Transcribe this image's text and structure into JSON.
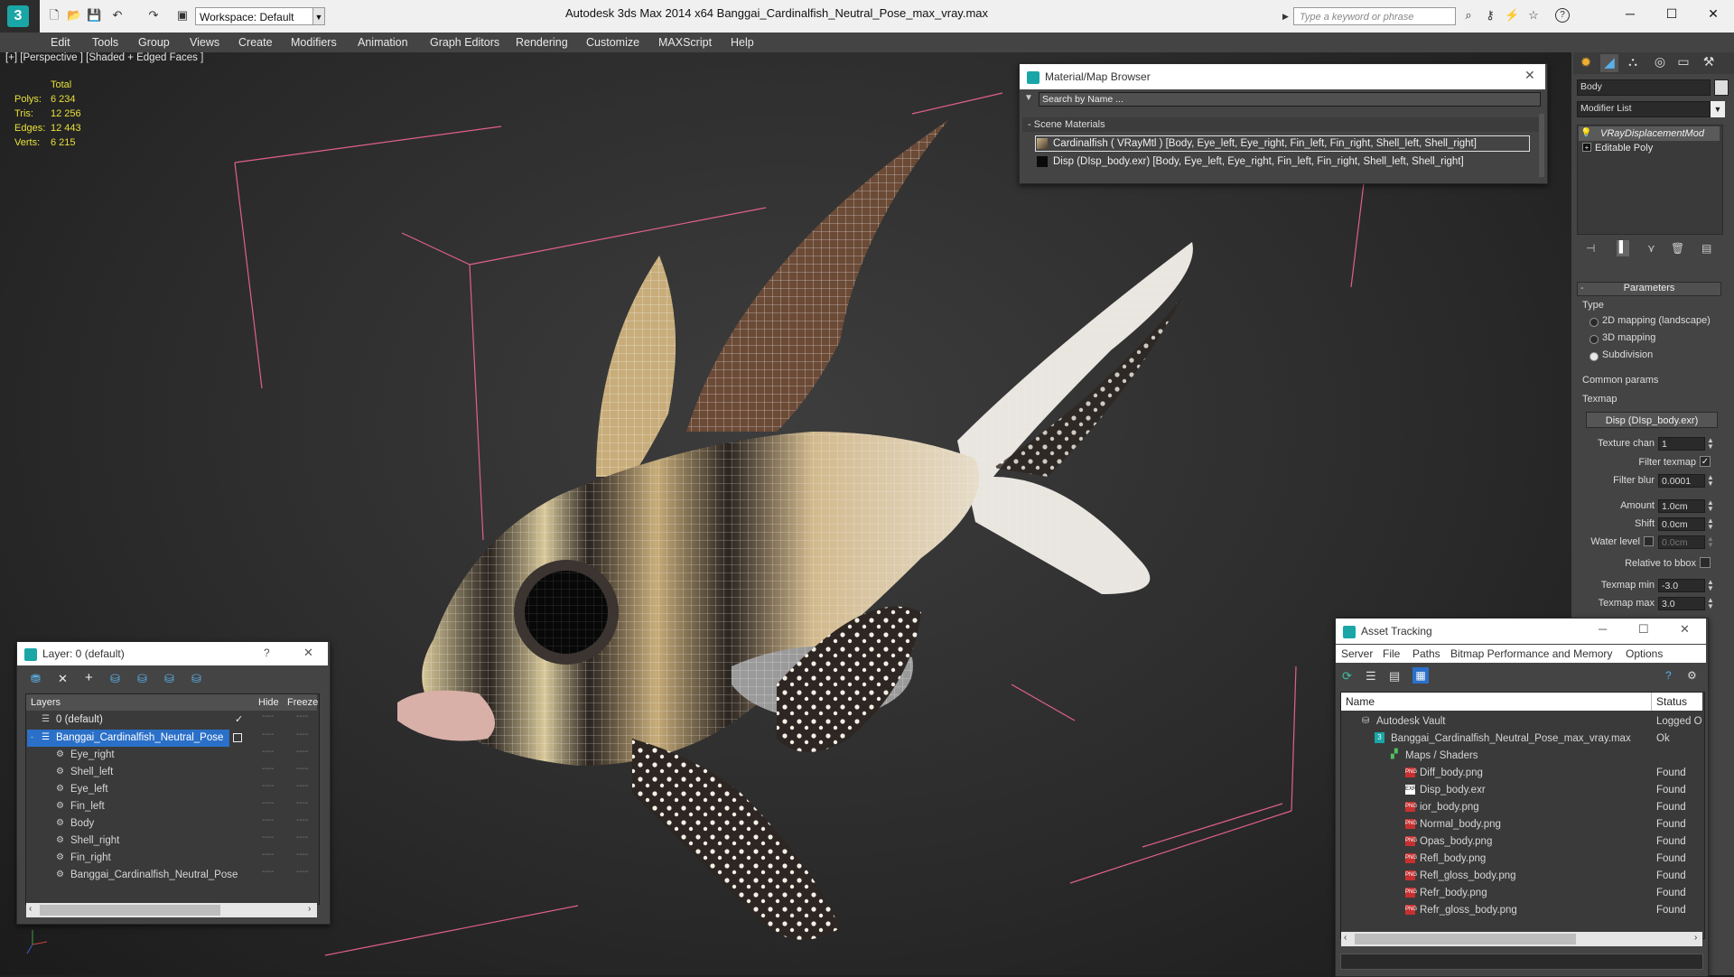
{
  "titlebar": {
    "workspace": "Workspace: Default",
    "app_title": "Autodesk 3ds Max  2014 x64        Banggai_Cardinalfish_Neutral_Pose_max_vray.max",
    "search_placeholder": "Type a keyword or phrase",
    "minimize": "─",
    "maximize": "☐",
    "close": "✕"
  },
  "menubar": {
    "items": [
      "Edit",
      "Tools",
      "Group",
      "Views",
      "Create",
      "Modifiers",
      "Animation",
      "Graph Editors",
      "Rendering",
      "Customize",
      "MAXScript",
      "Help"
    ]
  },
  "viewport": {
    "label": "[+] [Perspective ] [Shaded + Edged Faces ]",
    "stats": {
      "header": "Total",
      "rows": [
        {
          "name": "Polys:",
          "value": "6 234"
        },
        {
          "name": "Tris:",
          "value": "12 256"
        },
        {
          "name": "Edges:",
          "value": "12 443"
        },
        {
          "name": "Verts:",
          "value": "6 215"
        }
      ]
    }
  },
  "material_browser": {
    "title": "Material/Map Browser",
    "search_placeholder": "Search by Name ...",
    "section": "Scene Materials",
    "items": [
      "Cardinalfish ( VRayMtl ) [Body, Eye_left, Eye_right, Fin_left, Fin_right, Shell_left, Shell_right]",
      "Disp (DIsp_body.exr) [Body, Eye_left, Eye_right, Fin_left, Fin_right, Shell_left, Shell_right]"
    ]
  },
  "command_panel": {
    "object_name": "Body",
    "modifier_list": "Modifier List",
    "stack": [
      "VRayDisplacementMod",
      "Editable Poly"
    ],
    "rollout_title": "Parameters",
    "type_label": "Type",
    "type_options": [
      {
        "label": "2D mapping (landscape)",
        "checked": false
      },
      {
        "label": "3D mapping",
        "checked": false
      },
      {
        "label": "Subdivision",
        "checked": true
      }
    ],
    "common_params": "Common params",
    "texmap_label": "Texmap",
    "texmap_value": "Disp (DIsp_body.exr)",
    "texture_chan_label": "Texture chan",
    "texture_chan": "1",
    "filter_texmap_label": "Filter texmap",
    "filter_texmap_check": "✓",
    "filter_blur_label": "Filter blur",
    "filter_blur": "0.0001",
    "amount_label": "Amount",
    "amount": "1.0cm",
    "shift_label": "Shift",
    "shift": "0.0cm",
    "water_level_label": "Water level",
    "water_level": "0.0cm",
    "relative_label": "Relative to bbox",
    "texmap_min_label": "Texmap min",
    "texmap_min": "-3.0",
    "texmap_max_label": "Texmap max",
    "texmap_max": "3.0"
  },
  "layer_window": {
    "title": "Layer: 0 (default)",
    "help": "?",
    "close": "✕",
    "col_layers": "Layers",
    "col_hide": "Hide",
    "col_freeze": "Freeze",
    "rows": [
      {
        "label": "0 (default)",
        "indent": 1,
        "selected": false
      },
      {
        "label": "Banggai_Cardinalfish_Neutral_Pose",
        "indent": 1,
        "selected": true
      },
      {
        "label": "Eye_right",
        "indent": 2,
        "selected": false
      },
      {
        "label": "Shell_left",
        "indent": 2,
        "selected": false
      },
      {
        "label": "Eye_left",
        "indent": 2,
        "selected": false
      },
      {
        "label": "Fin_left",
        "indent": 2,
        "selected": false
      },
      {
        "label": "Body",
        "indent": 2,
        "selected": false
      },
      {
        "label": "Shell_right",
        "indent": 2,
        "selected": false
      },
      {
        "label": "Fin_right",
        "indent": 2,
        "selected": false
      },
      {
        "label": "Banggai_Cardinalfish_Neutral_Pose",
        "indent": 2,
        "selected": false
      }
    ],
    "dash": "----",
    "check": "✓"
  },
  "asset_tracking": {
    "title": "Asset Tracking",
    "menus": [
      "Server",
      "File",
      "Paths",
      "Bitmap Performance and Memory",
      "Options"
    ],
    "col_name": "Name",
    "col_status": "Status",
    "rows": [
      {
        "name": "Autodesk Vault",
        "status": "Logged O",
        "indent": 1,
        "kind": "vault"
      },
      {
        "name": "Banggai_Cardinalfish_Neutral_Pose_max_vray.max",
        "status": "Ok",
        "indent": 2,
        "kind": "max"
      },
      {
        "name": "Maps / Shaders",
        "status": "",
        "indent": 3,
        "kind": "folder"
      },
      {
        "name": "Diff_body.png",
        "status": "Found",
        "indent": 4,
        "kind": "png"
      },
      {
        "name": "Disp_body.exr",
        "status": "Found",
        "indent": 4,
        "kind": "exr"
      },
      {
        "name": "ior_body.png",
        "status": "Found",
        "indent": 4,
        "kind": "png"
      },
      {
        "name": "Normal_body.png",
        "status": "Found",
        "indent": 4,
        "kind": "png"
      },
      {
        "name": "Opas_body.png",
        "status": "Found",
        "indent": 4,
        "kind": "png"
      },
      {
        "name": "Refl_body.png",
        "status": "Found",
        "indent": 4,
        "kind": "png"
      },
      {
        "name": "Refl_gloss_body.png",
        "status": "Found",
        "indent": 4,
        "kind": "png"
      },
      {
        "name": "Refr_body.png",
        "status": "Found",
        "indent": 4,
        "kind": "png"
      },
      {
        "name": "Refr_gloss_body.png",
        "status": "Found",
        "indent": 4,
        "kind": "png"
      }
    ]
  },
  "colors": {
    "accent": "#2b70c8",
    "stats_text": "#e8e03a",
    "brand": "#1aa6a6"
  }
}
